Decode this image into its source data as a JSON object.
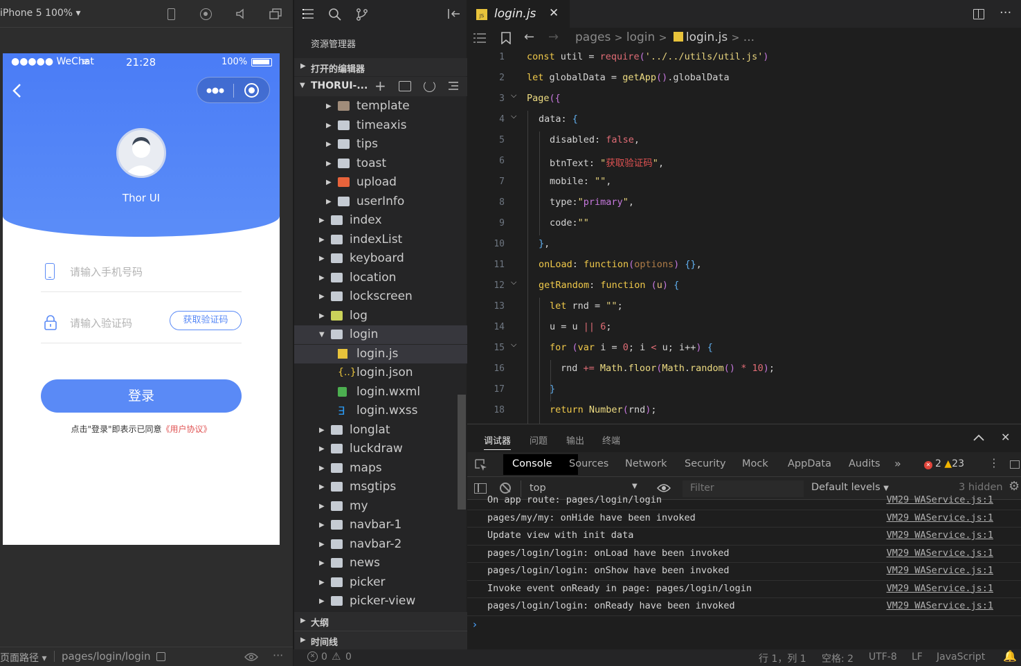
{
  "simulator": {
    "device": "iPhone 5 100%",
    "status_carrier": "●●●●● WeChat",
    "status_time": "21:28",
    "status_battery": "100%",
    "username": "Thor UI",
    "phone_placeholder": "请输入手机号码",
    "code_placeholder": "请输入验证码",
    "get_code_label": "获取验证码",
    "login_label": "登录",
    "agree_text": "点击\"登录\"即表示已同意",
    "agreement_link": "《用户协议》",
    "bottom_path_label": "页面路径",
    "bottom_path": "pages/login/login"
  },
  "explorer": {
    "title": "资源管理器",
    "open_editors": "打开的编辑器",
    "project": "THORUI-...",
    "outline": "大纲",
    "timeline": "时间线",
    "items": [
      {
        "label": "template",
        "icon": "folder-template-icon"
      },
      {
        "label": "timeaxis",
        "icon": "folder-icon"
      },
      {
        "label": "tips",
        "icon": "folder-icon"
      },
      {
        "label": "toast",
        "icon": "folder-icon"
      },
      {
        "label": "upload",
        "icon": "folder-upload-icon"
      },
      {
        "label": "userInfo",
        "icon": "folder-icon"
      },
      {
        "label": "index",
        "icon": "folder-icon"
      },
      {
        "label": "indexList",
        "icon": "folder-icon"
      },
      {
        "label": "keyboard",
        "icon": "folder-icon"
      },
      {
        "label": "location",
        "icon": "folder-icon"
      },
      {
        "label": "lockscreen",
        "icon": "folder-icon"
      },
      {
        "label": "log",
        "icon": "folder-log-icon"
      },
      {
        "label": "login",
        "icon": "folder-open-icon"
      },
      {
        "label": "login.js",
        "icon": "js-file-icon"
      },
      {
        "label": "login.json",
        "icon": "json-file-icon"
      },
      {
        "label": "login.wxml",
        "icon": "wxml-file-icon"
      },
      {
        "label": "login.wxss",
        "icon": "wxss-file-icon"
      },
      {
        "label": "longlat",
        "icon": "folder-icon"
      },
      {
        "label": "luckdraw",
        "icon": "folder-icon"
      },
      {
        "label": "maps",
        "icon": "folder-icon"
      },
      {
        "label": "msgtips",
        "icon": "folder-icon"
      },
      {
        "label": "my",
        "icon": "folder-icon"
      },
      {
        "label": "navbar-1",
        "icon": "folder-icon"
      },
      {
        "label": "navbar-2",
        "icon": "folder-icon"
      },
      {
        "label": "news",
        "icon": "folder-icon"
      },
      {
        "label": "picker",
        "icon": "folder-icon"
      },
      {
        "label": "picker-view",
        "icon": "folder-icon"
      }
    ]
  },
  "editor": {
    "tab_label": "login.js",
    "breadcrumb": [
      "pages",
      "login",
      "login.js",
      "..."
    ],
    "line_numbers": [
      "1",
      "2",
      "3",
      "4",
      "5",
      "6",
      "7",
      "8",
      "9",
      "10",
      "11",
      "12",
      "13",
      "14",
      "15",
      "16",
      "17",
      "18"
    ]
  },
  "devtools": {
    "panel_tabs": [
      "调试器",
      "问题",
      "输出",
      "终端"
    ],
    "tabs": [
      "Console",
      "Sources",
      "Network",
      "Security",
      "Mock",
      "AppData",
      "Audits"
    ],
    "errors": "2",
    "warnings": "23",
    "context": "top",
    "filter_placeholder": "Filter",
    "levels": "Default levels",
    "hidden": "3 hidden",
    "logs": [
      {
        "msg": "On app route: pages/login/login",
        "src": "VM29 WAService.js:1"
      },
      {
        "msg": "pages/my/my: onHide have been invoked",
        "src": "VM29 WAService.js:1"
      },
      {
        "msg": "Update view with init data",
        "src": "VM29 WAService.js:1"
      },
      {
        "msg": "pages/login/login: onLoad have been invoked",
        "src": "VM29 WAService.js:1"
      },
      {
        "msg": "pages/login/login: onShow have been invoked",
        "src": "VM29 WAService.js:1"
      },
      {
        "msg": "Invoke event onReady in page: pages/login/login",
        "src": "VM29 WAService.js:1"
      },
      {
        "msg": "pages/login/login: onReady have been invoked",
        "src": "VM29 WAService.js:1"
      }
    ]
  },
  "statusbar": {
    "errors": "0",
    "warnings": "0",
    "position": "行 1，列 1",
    "indent": "空格: 2",
    "encoding": "UTF-8",
    "eol": "LF",
    "language": "JavaScript"
  }
}
